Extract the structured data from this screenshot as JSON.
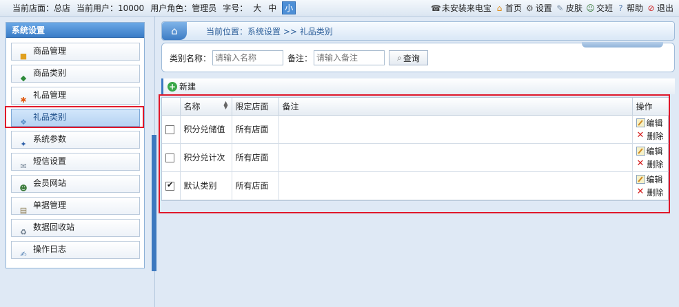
{
  "topbar": {
    "store_label": "当前店面：总店",
    "user_label": "当前用户：10000",
    "role_label": "用户角色：管理员",
    "font_label": "字号：",
    "font_sizes": [
      "大",
      "中",
      "小"
    ],
    "links": [
      {
        "icon": "phone-icon",
        "label": "未安装来电宝"
      },
      {
        "icon": "home-icon",
        "label": "首页"
      },
      {
        "icon": "gear-icon",
        "label": "设置"
      },
      {
        "icon": "skin-icon",
        "label": "皮肤"
      },
      {
        "icon": "handover-icon",
        "label": "交班"
      },
      {
        "icon": "help-icon",
        "label": "帮助"
      },
      {
        "icon": "exit-icon",
        "label": "退出"
      }
    ]
  },
  "sidebar": {
    "title": "系统设置",
    "items": [
      {
        "label": "商品管理",
        "icon": "product-icon"
      },
      {
        "label": "商品类别",
        "icon": "category-icon"
      },
      {
        "label": "礼品管理",
        "icon": "gift-icon"
      },
      {
        "label": "礼品类别",
        "icon": "gift-category-icon"
      },
      {
        "label": "系统参数",
        "icon": "params-icon"
      },
      {
        "label": "短信设置",
        "icon": "sms-icon"
      },
      {
        "label": "会员网站",
        "icon": "member-site-icon"
      },
      {
        "label": "单据管理",
        "icon": "receipt-icon"
      },
      {
        "label": "数据回收站",
        "icon": "recycle-icon"
      },
      {
        "label": "操作日志",
        "icon": "log-icon"
      }
    ],
    "active_index": 3
  },
  "breadcrumb": {
    "text": "当前位置：系统设置 >> 礼品类别"
  },
  "search": {
    "name_label": "类别名称：",
    "name_placeholder": "请输入名称",
    "remark_label": "备注：",
    "remark_placeholder": "请输入备注",
    "query_label": "查询"
  },
  "toolbar": {
    "new_label": "新建"
  },
  "table": {
    "headers": [
      "名称",
      "限定店面",
      "备注",
      "操作"
    ],
    "edit_label": "编辑",
    "delete_label": "删除",
    "rows": [
      {
        "name": "积分兑储值",
        "store": "所有店面",
        "remark": "",
        "checked": false
      },
      {
        "name": "积分兑计次",
        "store": "所有店面",
        "remark": "",
        "checked": false
      },
      {
        "name": "默认类别",
        "store": "所有店面",
        "remark": "",
        "checked": true
      }
    ]
  },
  "colors": {
    "accent": "#3a7cc7",
    "highlight": "#e0182a"
  }
}
